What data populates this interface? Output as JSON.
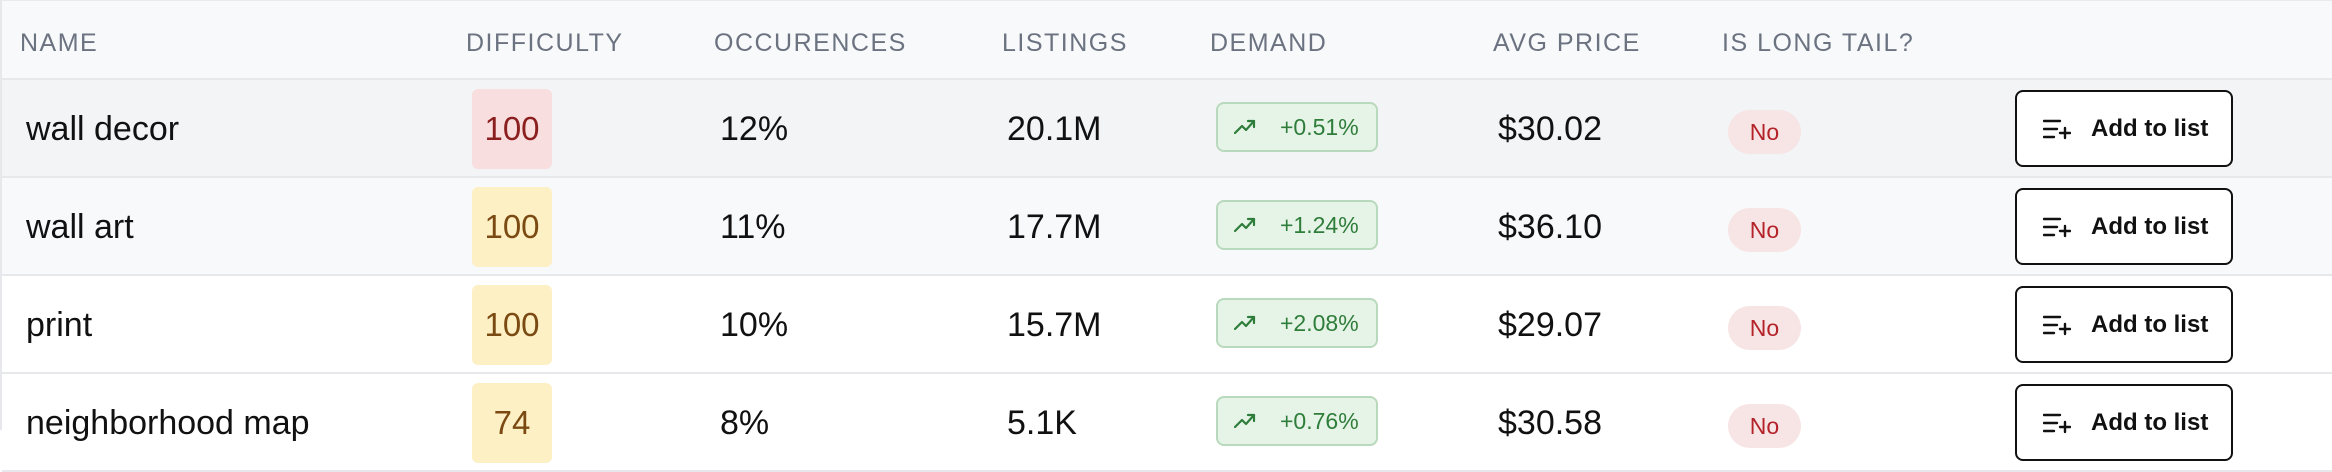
{
  "headers": {
    "name": "NAME",
    "difficulty": "DIFFICULTY",
    "occurences": "OCCURENCES",
    "listings": "LISTINGS",
    "demand": "DEMAND",
    "avg_price": "AVG PRICE",
    "long_tail": "IS LONG TAIL?"
  },
  "colors": {
    "difficulty_high": "#f8dede",
    "difficulty_medium": "#fdf0c4",
    "demand_positive": "#e6f4e8",
    "long_tail_no": "#f7e4e4"
  },
  "icons": {
    "trend": "trending-up-icon",
    "add_to_list": "list-plus-icon"
  },
  "rows": [
    {
      "name": "wall decor",
      "difficulty": "100",
      "difficulty_level": "high",
      "occurences": "12%",
      "listings": "20.1M",
      "demand": "+0.51%",
      "avg_price": "$30.02",
      "long_tail": "No",
      "action": "Add to list"
    },
    {
      "name": "wall art",
      "difficulty": "100",
      "difficulty_level": "medium",
      "occurences": "11%",
      "listings": "17.7M",
      "demand": "+1.24%",
      "avg_price": "$36.10",
      "long_tail": "No",
      "action": "Add to list"
    },
    {
      "name": "print",
      "difficulty": "100",
      "difficulty_level": "medium",
      "occurences": "10%",
      "listings": "15.7M",
      "demand": "+2.08%",
      "avg_price": "$29.07",
      "long_tail": "No",
      "action": "Add to list"
    },
    {
      "name": "neighborhood map",
      "difficulty": "74",
      "difficulty_level": "medium",
      "occurences": "8%",
      "listings": "5.1K",
      "demand": "+0.76%",
      "avg_price": "$30.58",
      "long_tail": "No",
      "action": "Add to list"
    }
  ]
}
